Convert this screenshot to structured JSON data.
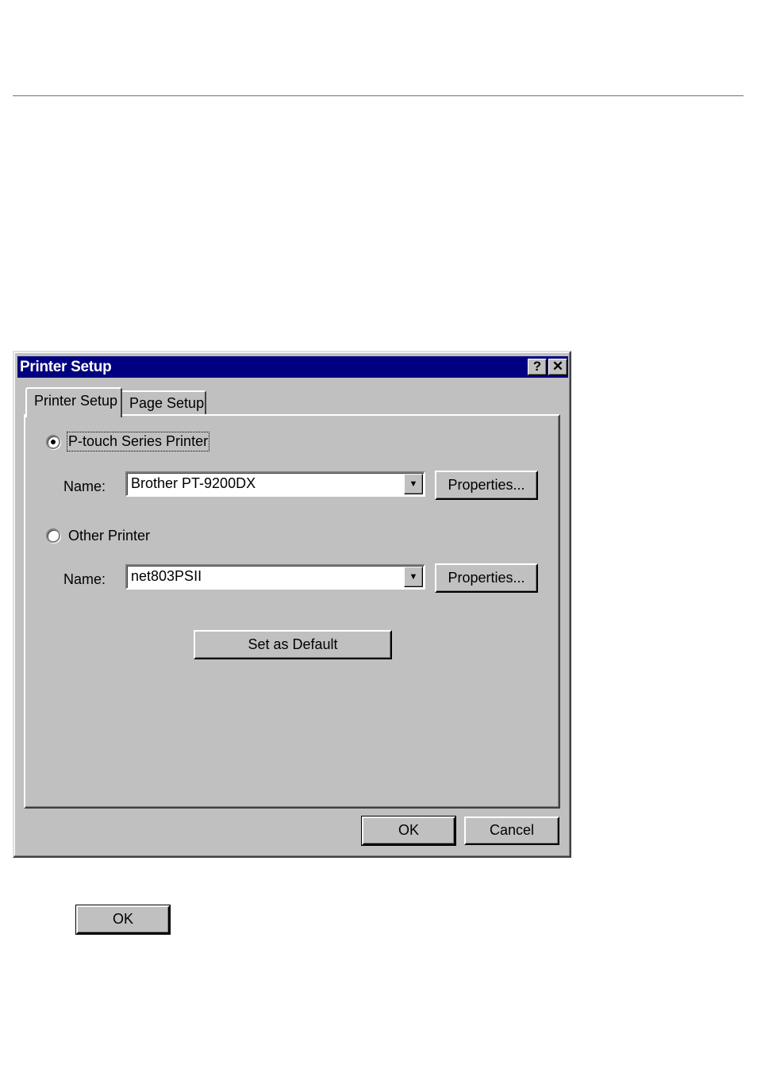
{
  "dialog": {
    "title": "Printer Setup",
    "help_glyph": "?",
    "close_glyph": "✕",
    "tabs": [
      {
        "label": "Printer Setup",
        "active": true
      },
      {
        "label": "Page Setup",
        "active": false
      }
    ],
    "ptouch_option": {
      "label": "P-touch Series Printer",
      "selected": true
    },
    "ptouch_name_label": "Name:",
    "ptouch_printer_value": "Brother PT-9200DX",
    "ptouch_properties_label": "Properties...",
    "other_option": {
      "label": "Other Printer",
      "selected": false
    },
    "other_name_label": "Name:",
    "other_printer_value": "net803PSII",
    "other_properties_label": "Properties...",
    "set_default_label": "Set as Default",
    "ok_label": "OK",
    "cancel_label": "Cancel",
    "dropdown_glyph": "▼"
  },
  "standalone_ok_label": "OK",
  "icons": [
    "help-icon",
    "close-icon",
    "dropdown-arrow-icon"
  ],
  "colors": {
    "titlebar": "#000080",
    "face": "#c0c0c0"
  }
}
